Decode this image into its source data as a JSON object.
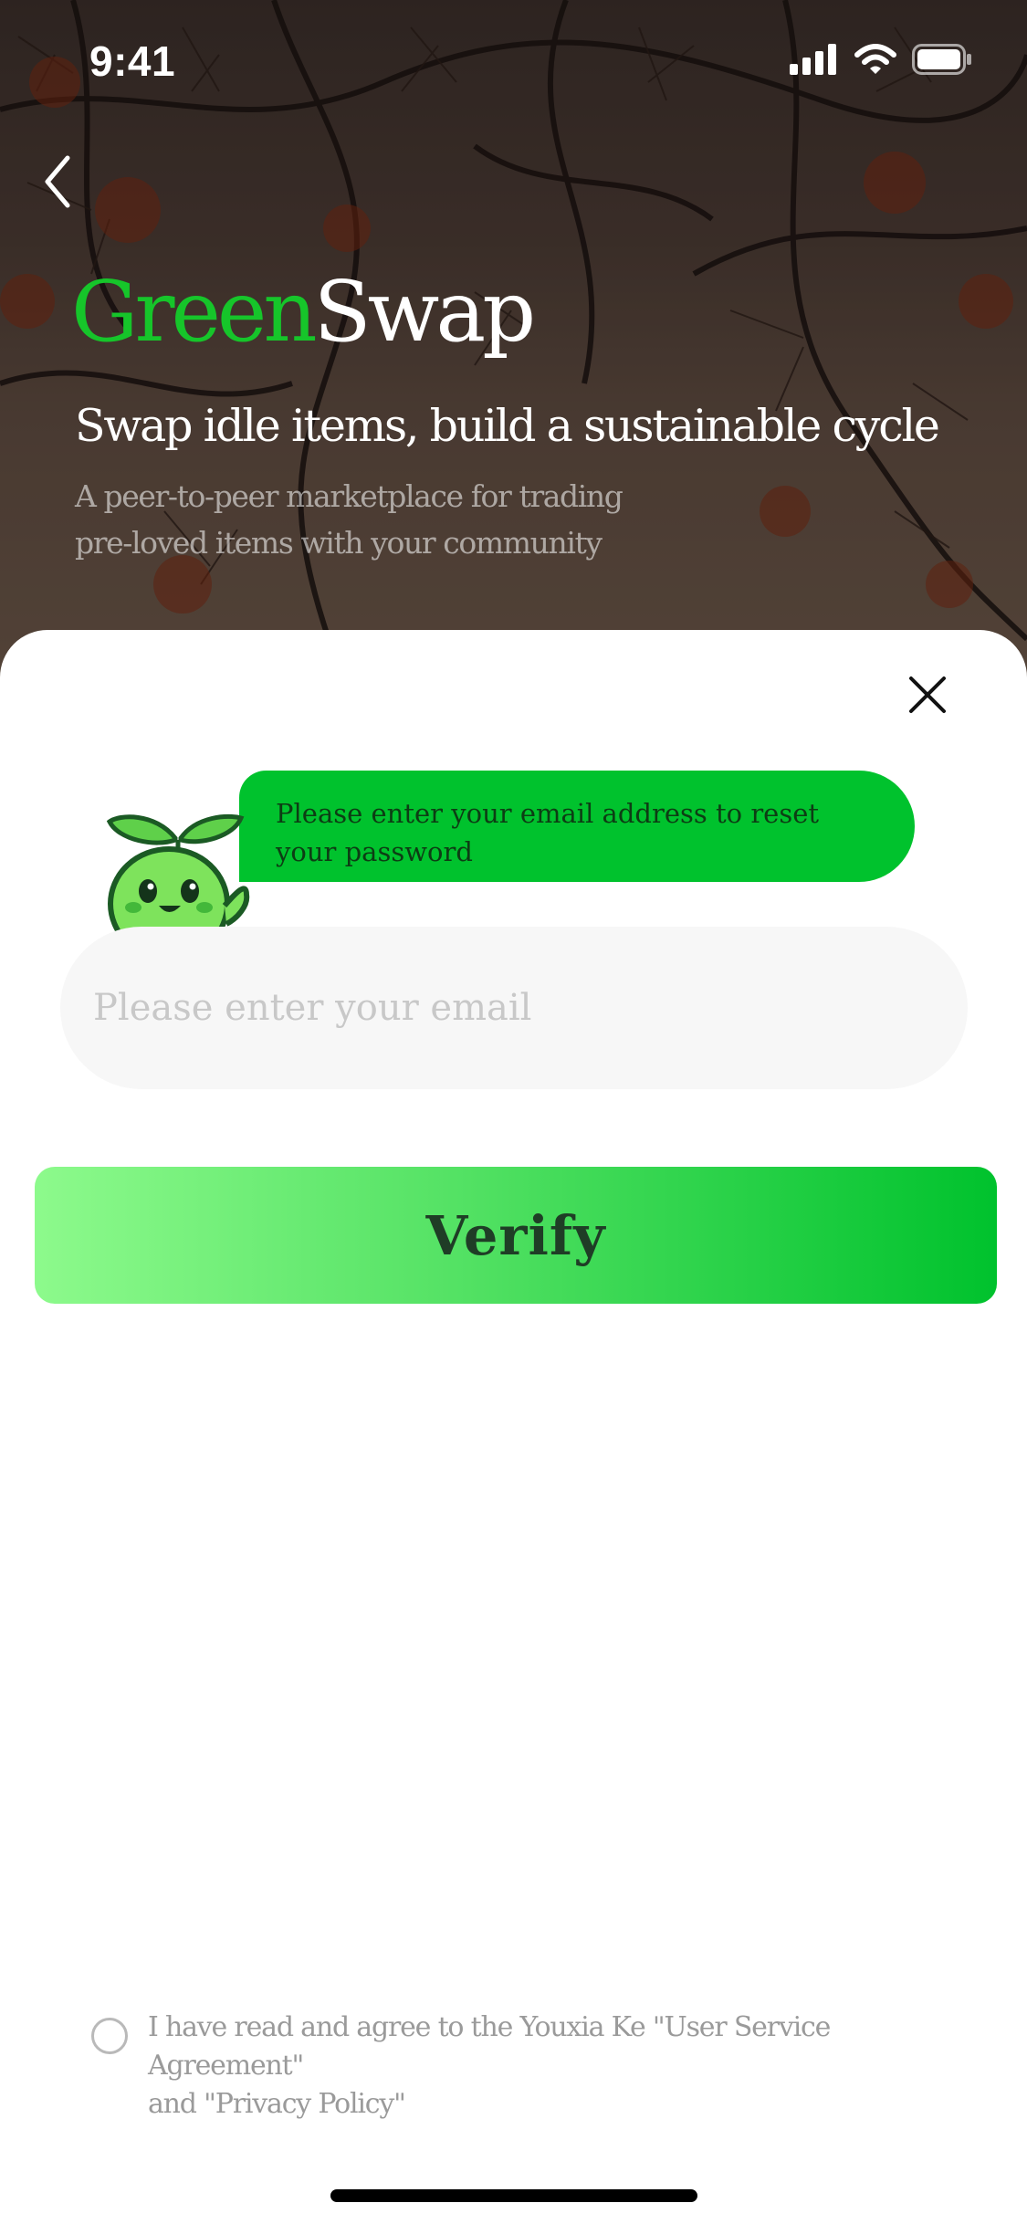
{
  "status_bar": {
    "time": "9:41"
  },
  "hero": {
    "brand_part1": "Green",
    "brand_part2": "Swap",
    "tagline": "Swap idle items, build a sustainable cycle",
    "subtitle_line1": "A peer-to-peer marketplace for trading",
    "subtitle_line2": "pre-loved items with your community"
  },
  "dialog": {
    "message": "Please enter your email address to reset your password",
    "email_placeholder": "Please enter your email",
    "email_value": "",
    "verify_label": "Verify"
  },
  "agreement": {
    "text_line1": "I have read and agree to the Youxia Ke \"User Service Agreement\"",
    "text_line2": "and \"Privacy Policy\"",
    "checked": false
  },
  "colors": {
    "brand_green": "#16c52a",
    "bubble": "#00c22d",
    "button_start": "#8dfa8c",
    "button_end": "#00c22d"
  },
  "icons": [
    "back-chevron-icon",
    "close-icon",
    "signal-icon",
    "wifi-icon",
    "battery-icon",
    "sprout-mascot-icon"
  ]
}
